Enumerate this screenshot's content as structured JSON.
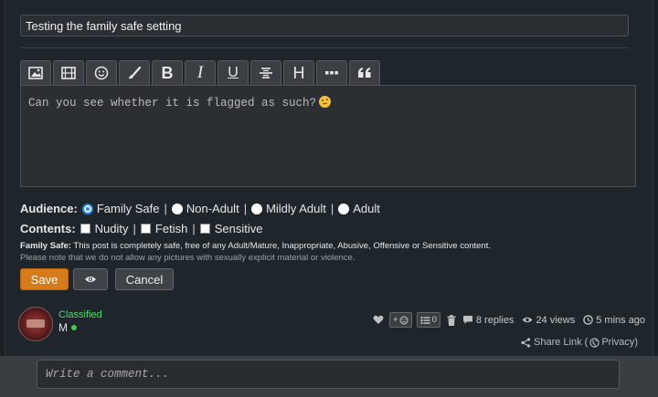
{
  "post": {
    "title": "Testing the family safe setting",
    "body": "Can you see whether it is flagged as such?",
    "body_emoji": "thinking-face"
  },
  "toolbar": {
    "buttons": [
      "image",
      "video",
      "emoji",
      "brush",
      "bold",
      "italic",
      "underline",
      "strikethrough",
      "heading",
      "more",
      "quote"
    ],
    "heading_glyph": "H",
    "bold_glyph": "B",
    "italic_glyph": "I",
    "underline_glyph": "U"
  },
  "audience": {
    "label": "Audience:",
    "options": [
      "Family Safe",
      "Non-Adult",
      "Mildly Adult",
      "Adult"
    ],
    "selected": "Family Safe"
  },
  "contents": {
    "label": "Contents:",
    "options": [
      "Nudity",
      "Fetish",
      "Sensitive"
    ]
  },
  "info": {
    "lead": "Family Safe:",
    "text": " This post is completely safe, free of any Adult/Mature, Inappropriate, Abusive, Offensive or Sensitive content.",
    "note": "Please note that we do not allow any pictures with sexually explicit material or violence."
  },
  "actions": {
    "save": "Save",
    "cancel": "Cancel"
  },
  "author": {
    "role": "Classified",
    "name": "M"
  },
  "stats": {
    "reaction_add": "+",
    "list_count": "0",
    "replies": "8 replies",
    "views": "24 views",
    "time": "5 mins ago"
  },
  "share": {
    "label": "Share Link (",
    "privacy": "Privacy)"
  },
  "comment": {
    "placeholder": "Write a comment..."
  },
  "colors": {
    "accent": "#d57b1a",
    "role": "#4cd96c",
    "online": "#43c94b"
  }
}
